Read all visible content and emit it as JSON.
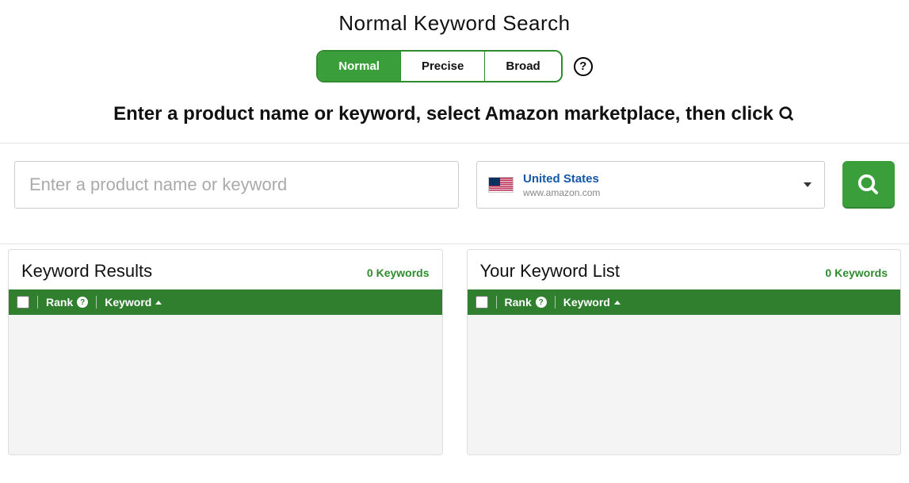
{
  "title": "Normal Keyword Search",
  "tabs": {
    "normal": "Normal",
    "precise": "Precise",
    "broad": "Broad"
  },
  "instruction_text": "Enter a product name or keyword, select Amazon marketplace, then click",
  "search": {
    "placeholder": "Enter a product name or keyword"
  },
  "marketplace": {
    "name": "United States",
    "domain": "www.amazon.com"
  },
  "panels": {
    "results": {
      "title": "Keyword Results",
      "count_label": "0 Keywords",
      "columns": {
        "rank": "Rank",
        "keyword": "Keyword"
      }
    },
    "list": {
      "title": "Your Keyword List",
      "count_label": "0 Keywords",
      "columns": {
        "rank": "Rank",
        "keyword": "Keyword"
      }
    }
  }
}
